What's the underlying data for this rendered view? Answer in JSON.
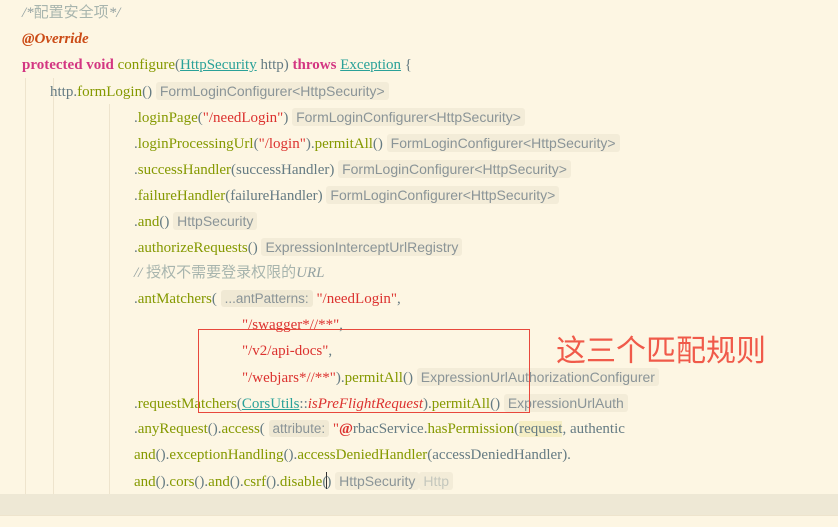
{
  "app": {
    "kind": "code-editor",
    "theme": "solarized-light",
    "language": "Java",
    "background_color": "#fdf6e3",
    "current_line_highlight_color": "#eee8d5",
    "annotation_color": "#e8483c"
  },
  "annotation": {
    "rectangle_label": "red-highlight-rectangle",
    "note_text": "这三个匹配规则",
    "note_color": "#f05a4a"
  },
  "code": {
    "lines": [
      {
        "id": "line-comment-config",
        "indent": "ind0",
        "tokens": [
          {
            "cls": "cmt",
            "text": "/*"
          },
          {
            "cls": "cmt-cn",
            "text": "配置安全项"
          },
          {
            "cls": "cmt",
            "text": "*/"
          }
        ]
      },
      {
        "id": "line-override",
        "indent": "ind0",
        "tokens": [
          {
            "cls": "anno",
            "text": "@Override"
          }
        ]
      },
      {
        "id": "line-method-signature",
        "indent": "ind0",
        "tokens": [
          {
            "cls": "kw",
            "text": "protected "
          },
          {
            "cls": "kw",
            "text": "void "
          },
          {
            "cls": "method",
            "text": "configure"
          },
          {
            "cls": "punct",
            "text": "("
          },
          {
            "cls": "type",
            "text": "HttpSecurity"
          },
          {
            "cls": "plain",
            "text": " http"
          },
          {
            "cls": "punct",
            "text": ") "
          },
          {
            "cls": "kw",
            "text": "throws "
          },
          {
            "cls": "type",
            "text": "Exception"
          },
          {
            "cls": "punct",
            "text": " {"
          }
        ]
      },
      {
        "id": "line-formlogin",
        "indent": "ind1",
        "tokens": [
          {
            "cls": "plain",
            "text": "http."
          },
          {
            "cls": "method",
            "text": "formLogin"
          },
          {
            "cls": "punct",
            "text": "() "
          },
          {
            "cls": "hint",
            "text": "FormLoginConfigurer<HttpSecurity>"
          }
        ]
      },
      {
        "id": "line-loginpage",
        "indent": "ind3",
        "tokens": [
          {
            "cls": "punct",
            "text": "."
          },
          {
            "cls": "method",
            "text": "loginPage"
          },
          {
            "cls": "punct",
            "text": "("
          },
          {
            "cls": "str",
            "text": "\"/needLogin\""
          },
          {
            "cls": "punct",
            "text": ") "
          },
          {
            "cls": "hint",
            "text": "FormLoginConfigurer<HttpSecurity>"
          }
        ]
      },
      {
        "id": "line-loginprocessingurl",
        "indent": "ind3",
        "tokens": [
          {
            "cls": "punct",
            "text": "."
          },
          {
            "cls": "method",
            "text": "loginProcessingUrl"
          },
          {
            "cls": "punct",
            "text": "("
          },
          {
            "cls": "str",
            "text": "\"/login\""
          },
          {
            "cls": "punct",
            "text": ")."
          },
          {
            "cls": "method",
            "text": "permitAll"
          },
          {
            "cls": "punct",
            "text": "() "
          },
          {
            "cls": "hint",
            "text": "FormLoginConfigurer<HttpSecurity>"
          }
        ]
      },
      {
        "id": "line-successhandler",
        "indent": "ind3",
        "tokens": [
          {
            "cls": "punct",
            "text": "."
          },
          {
            "cls": "method",
            "text": "successHandler"
          },
          {
            "cls": "punct",
            "text": "("
          },
          {
            "cls": "plain",
            "text": "successHandler"
          },
          {
            "cls": "punct",
            "text": ") "
          },
          {
            "cls": "hint",
            "text": "FormLoginConfigurer<HttpSecurity>"
          }
        ]
      },
      {
        "id": "line-failurehandler",
        "indent": "ind3",
        "tokens": [
          {
            "cls": "punct",
            "text": "."
          },
          {
            "cls": "method",
            "text": "failureHandler"
          },
          {
            "cls": "punct",
            "text": "("
          },
          {
            "cls": "plain",
            "text": "failureHandler"
          },
          {
            "cls": "punct",
            "text": ") "
          },
          {
            "cls": "hint",
            "text": "FormLoginConfigurer<HttpSecurity>"
          }
        ]
      },
      {
        "id": "line-and",
        "indent": "ind3",
        "tokens": [
          {
            "cls": "punct",
            "text": "."
          },
          {
            "cls": "method",
            "text": "and"
          },
          {
            "cls": "punct",
            "text": "() "
          },
          {
            "cls": "hint",
            "text": "HttpSecurity"
          }
        ]
      },
      {
        "id": "line-authorizerequests",
        "indent": "ind3",
        "tokens": [
          {
            "cls": "punct",
            "text": "."
          },
          {
            "cls": "method",
            "text": "authorizeRequests"
          },
          {
            "cls": "punct",
            "text": "() "
          },
          {
            "cls": "hint",
            "text": "ExpressionInterceptUrlRegistry"
          }
        ]
      },
      {
        "id": "line-comment-url",
        "indent": "ind3",
        "tokens": [
          {
            "cls": "cmt",
            "text": "// "
          },
          {
            "cls": "cmt-cn",
            "text": "授权不需要登录权限的"
          },
          {
            "cls": "cmt",
            "text": "URL"
          }
        ]
      },
      {
        "id": "line-antmatchers",
        "indent": "ind3",
        "tokens": [
          {
            "cls": "punct",
            "text": "."
          },
          {
            "cls": "method",
            "text": "antMatchers"
          },
          {
            "cls": "punct",
            "text": "( "
          },
          {
            "cls": "phint",
            "text": "...antPatterns:"
          },
          {
            "cls": "punct",
            "text": " "
          },
          {
            "cls": "str",
            "text": "\"/needLogin\""
          },
          {
            "cls": "punct",
            "text": ","
          }
        ]
      },
      {
        "id": "line-pattern-swagger",
        "indent": "ind4",
        "tokens": [
          {
            "cls": "str",
            "text": "\"/swagger*//**\""
          },
          {
            "cls": "punct",
            "text": ","
          }
        ]
      },
      {
        "id": "line-pattern-apidocs",
        "indent": "ind4",
        "tokens": [
          {
            "cls": "str",
            "text": "\"/v2/api-docs\""
          },
          {
            "cls": "punct",
            "text": ","
          }
        ]
      },
      {
        "id": "line-pattern-webjars",
        "indent": "ind4",
        "tokens": [
          {
            "cls": "str",
            "text": "\"/webjars*//**\""
          },
          {
            "cls": "punct",
            "text": ")."
          },
          {
            "cls": "method",
            "text": "permitAll"
          },
          {
            "cls": "punct",
            "text": "() "
          },
          {
            "cls": "hint",
            "text": "ExpressionUrlAuthorizationConfigurer"
          }
        ]
      },
      {
        "id": "line-requestmatchers",
        "indent": "ind3",
        "tokens": [
          {
            "cls": "punct",
            "text": "."
          },
          {
            "cls": "method",
            "text": "requestMatchers"
          },
          {
            "cls": "punct",
            "text": "("
          },
          {
            "cls": "type",
            "text": "CorsUtils"
          },
          {
            "cls": "punct",
            "text": "::"
          },
          {
            "cls": "ital",
            "text": "isPreFlightRequest"
          },
          {
            "cls": "punct",
            "text": ")."
          },
          {
            "cls": "method",
            "text": "permitAll"
          },
          {
            "cls": "punct",
            "text": "() "
          },
          {
            "cls": "hint",
            "text": "ExpressionUrlAuth"
          }
        ]
      },
      {
        "id": "line-anyrequest",
        "indent": "ind3",
        "tokens": [
          {
            "cls": "punct",
            "text": "."
          },
          {
            "cls": "method",
            "text": "anyRequest"
          },
          {
            "cls": "punct",
            "text": "()."
          },
          {
            "cls": "method",
            "text": "access"
          },
          {
            "cls": "punct",
            "text": "( "
          },
          {
            "cls": "phint",
            "text": "attribute:"
          },
          {
            "cls": "punct",
            "text": " "
          },
          {
            "cls": "str",
            "text": "\""
          },
          {
            "cls": "atsym",
            "text": "@"
          },
          {
            "cls": "plain",
            "text": "rbacService."
          },
          {
            "cls": "method",
            "text": "hasPermission"
          },
          {
            "cls": "punct",
            "text": "("
          },
          {
            "cls": "hl-arg",
            "text": "request"
          },
          {
            "cls": "plain",
            "text": ", authentic"
          }
        ]
      },
      {
        "id": "line-exceptionhandling",
        "indent": "ind3",
        "tokens": [
          {
            "cls": "method",
            "text": "and"
          },
          {
            "cls": "punct",
            "text": "()."
          },
          {
            "cls": "method",
            "text": "exceptionHandling"
          },
          {
            "cls": "punct",
            "text": "()."
          },
          {
            "cls": "method",
            "text": "accessDeniedHandler"
          },
          {
            "cls": "punct",
            "text": "("
          },
          {
            "cls": "plain",
            "text": "accessDeniedHandler"
          },
          {
            "cls": "punct",
            "text": ")."
          }
        ]
      },
      {
        "id": "line-cors-csrf",
        "indent": "ind3",
        "current": true,
        "tokens": [
          {
            "cls": "method",
            "text": "and"
          },
          {
            "cls": "punct",
            "text": "()."
          },
          {
            "cls": "method",
            "text": "cors"
          },
          {
            "cls": "punct",
            "text": "()."
          },
          {
            "cls": "method",
            "text": "and"
          },
          {
            "cls": "punct",
            "text": "()."
          },
          {
            "cls": "method",
            "text": "csrf"
          },
          {
            "cls": "punct",
            "text": "()."
          },
          {
            "cls": "method",
            "text": "disable"
          },
          {
            "cls": "punct",
            "text": "("
          },
          {
            "cls": "caret",
            "text": ""
          },
          {
            "cls": "punct",
            "text": ") "
          },
          {
            "cls": "hint",
            "text": "HttpSecurity"
          },
          {
            "cls": "hint ghost",
            "text": "Http"
          }
        ]
      }
    ]
  }
}
